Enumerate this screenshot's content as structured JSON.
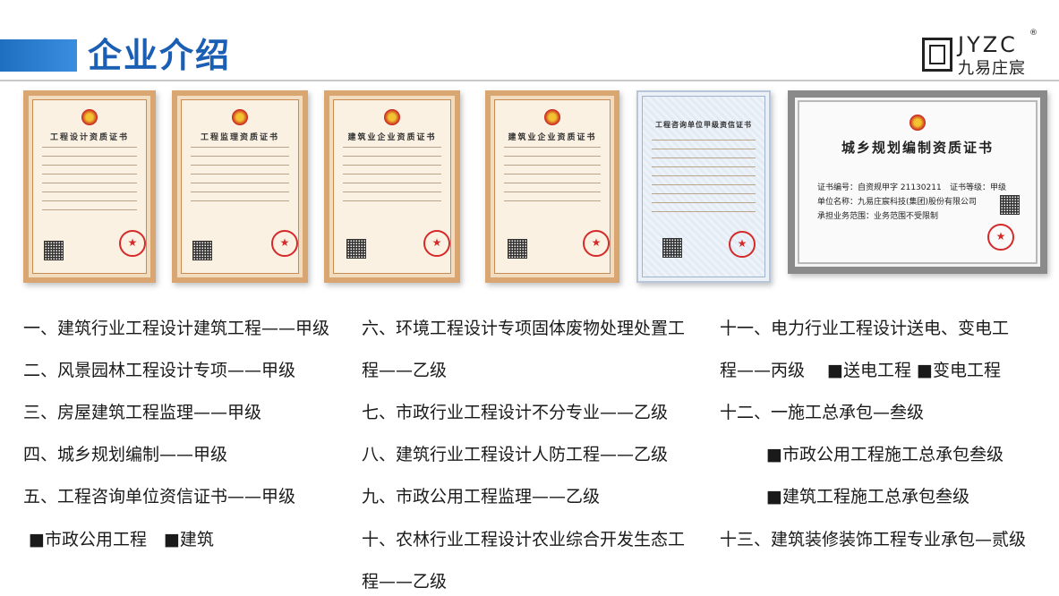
{
  "header": {
    "title": "企业介绍",
    "logo_en": "JYZC",
    "logo_cn": "九易庄宸",
    "logo_reg": "®"
  },
  "certificates": [
    {
      "title": "工程设计资质证书"
    },
    {
      "title": "工程监理资质证书"
    },
    {
      "title": "建筑业企业资质证书"
    },
    {
      "title": "建筑业企业资质证书"
    },
    {
      "title": "工程咨询单位甲级资信证书"
    },
    {
      "title": "城乡规划编制资质证书",
      "cert_no": "证书编号：",
      "cert_no_value": "自资规甲字 21130211",
      "grade": "证书等级：",
      "grade_value": "甲级",
      "unit": "单位名称：",
      "unit_value": "九易庄宸科技(集团)股份有限公司",
      "scope": "承担业务范围：",
      "scope_value": "业务范围不受限制"
    }
  ],
  "col1": [
    "一、建筑行业工程设计建筑工程——甲级",
    "二、风景园林工程设计专项——甲级",
    "三、房屋建筑工程监理——甲级",
    "四、城乡规划编制——甲级",
    "五、工程咨询单位资信证书——甲级",
    "■市政公用工程　■建筑"
  ],
  "col2": [
    "六、环境工程设计专项固体废物处理处置工",
    "程——乙级",
    "七、市政行业工程设计不分专业——乙级",
    "八、建筑行业工程设计人防工程——乙级",
    "九、市政公用工程监理——乙级",
    "十、农林行业工程设计农业综合开发生态工",
    "程——乙级"
  ],
  "col3": [
    "十一、电力行业工程设计送电、变电工",
    "程——丙级　 ■送电工程 ■变电工程",
    "十二、一施工总承包—叁级",
    "■市政公用工程施工总承包叁级",
    "■建筑工程施工总承包叁级",
    "十三、建筑装修装饰工程专业承包—贰级"
  ]
}
